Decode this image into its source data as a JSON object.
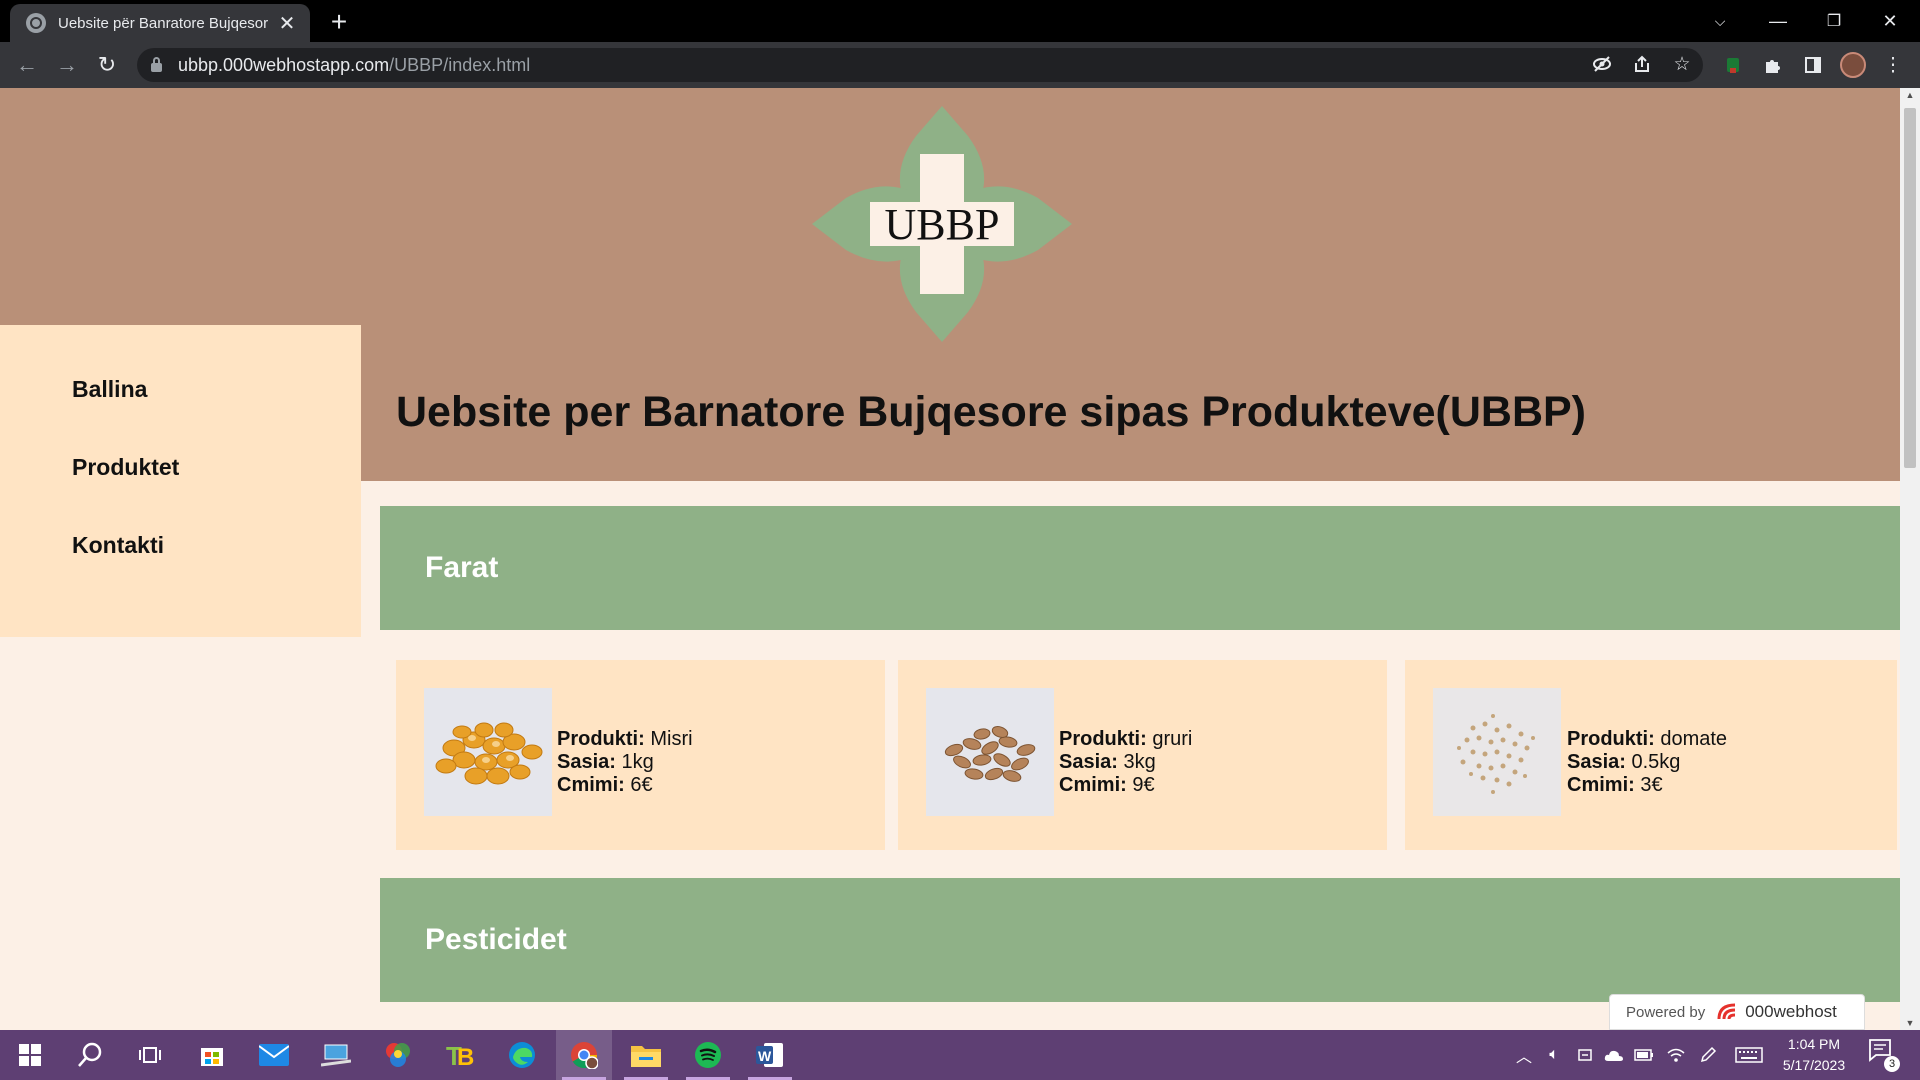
{
  "browser": {
    "tab_title": "Uebsite për Banratore Bujqesore",
    "url_host": "ubbp.000webhostapp.com",
    "url_path": "/UBBP/index.html"
  },
  "page": {
    "logo_text": "UBBP",
    "title": "Uebsite per Barnatore Bujqesore sipas Produkteve(UBBP)",
    "nav": [
      {
        "label": "Ballina"
      },
      {
        "label": "Produktet"
      },
      {
        "label": "Kontakti"
      }
    ],
    "sections": [
      {
        "title": "Farat"
      },
      {
        "title": "Pesticidet"
      }
    ],
    "field_labels": {
      "product": "Produkti:",
      "quantity": "Sasia:",
      "price": "Cmimi:"
    },
    "products": [
      {
        "name": "Misri",
        "quantity": "1kg",
        "price": "6€"
      },
      {
        "name": "gruri",
        "quantity": "3kg",
        "price": "9€"
      },
      {
        "name": "domate",
        "quantity": "0.5kg",
        "price": "3€"
      }
    ],
    "powered_by": {
      "prefix": "Powered by",
      "brand": "000webhost"
    }
  },
  "taskbar": {
    "time": "1:04 PM",
    "date": "5/17/2023",
    "notification_count": "3"
  },
  "colors": {
    "header_bg": "#b99078",
    "sidebar_bg": "#ffe4c4",
    "section_bar": "#8fb187",
    "page_bg": "#fcf0e6",
    "logo_green": "#8fb187",
    "logo_cross": "#fcf0e6",
    "taskbar": "#5e3f73"
  }
}
